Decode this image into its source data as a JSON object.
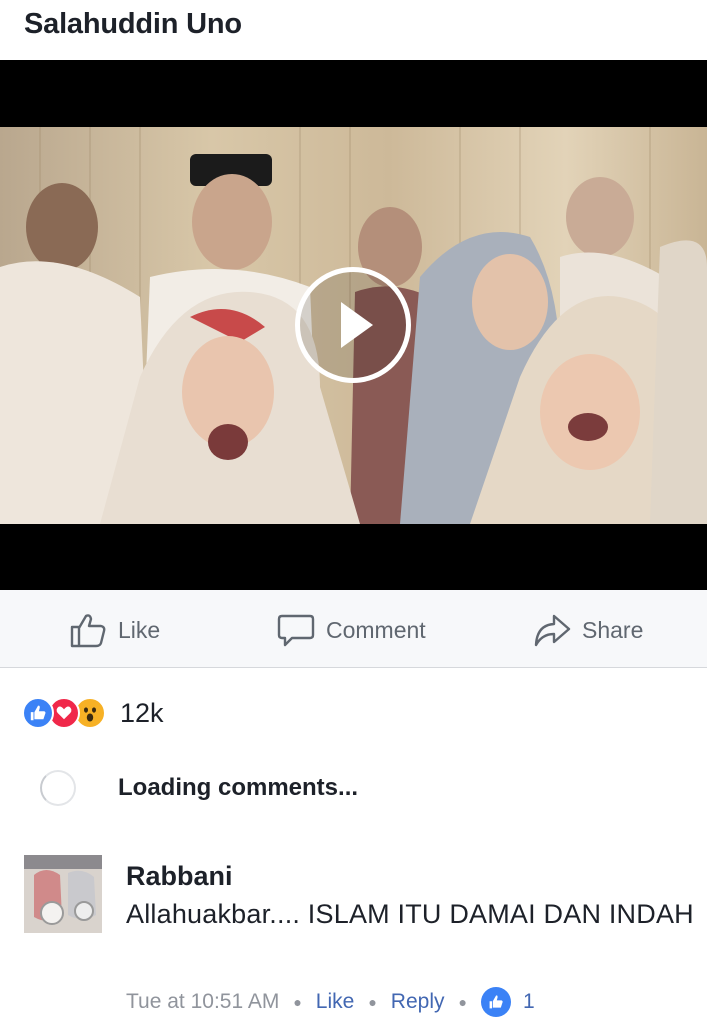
{
  "post": {
    "author": "Salahuddin Uno"
  },
  "video": {
    "play_icon": "play-icon"
  },
  "actions": {
    "like": "Like",
    "comment": "Comment",
    "share": "Share"
  },
  "reactions": {
    "icons": [
      "like-reaction-icon",
      "love-reaction-icon",
      "wow-reaction-icon"
    ],
    "count": "12k"
  },
  "loading": {
    "text": "Loading comments..."
  },
  "comment": {
    "author": "Rabbani",
    "text": "Allahuakbar.... ISLAM ITU DAMAI DAN INDAH",
    "time": "Tue at 10:51 AM",
    "like_label": "Like",
    "reply_label": "Reply",
    "like_count": "1"
  },
  "colors": {
    "link_blue": "#4267b2",
    "like_blue": "#3b82f6",
    "love_red": "#f0284a",
    "wow_yellow": "#f7b125",
    "muted": "#606770"
  }
}
